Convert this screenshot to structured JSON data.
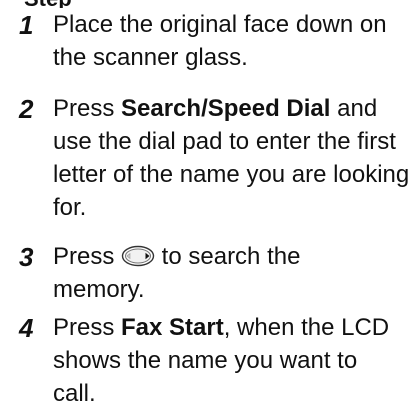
{
  "heading_fragment": "Step",
  "steps": [
    {
      "number": "1",
      "text": "Place the original face down on the scanner glass."
    },
    {
      "number": "2",
      "pre": "Press ",
      "bold": "Search/Speed Dial",
      "post": " and use the dial pad to enter the first letter of the name you are looking for."
    },
    {
      "number": "3",
      "pre": "Press ",
      "icon": "navigation-dial-right-arrow-icon",
      "post": " to search the memory."
    },
    {
      "number": "4",
      "pre": "Press ",
      "bold": "Fax Start",
      "post": ", when the LCD shows the name you want to call."
    }
  ]
}
